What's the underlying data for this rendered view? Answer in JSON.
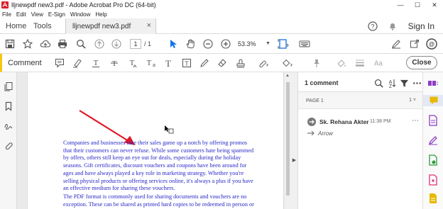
{
  "window": {
    "title": "lljnewpdf new3.pdf - Adobe Acrobat Pro DC (64-bit)",
    "controls": {
      "minimize": "—",
      "maximize": "☐",
      "close": "✕"
    }
  },
  "menubar": {
    "items": [
      "File",
      "Edit",
      "View",
      "E-Sign",
      "Window",
      "Help"
    ]
  },
  "tabs": {
    "home": "Home",
    "tools": "Tools",
    "document": "lljnewpdf new3.pdf",
    "close_glyph": "×"
  },
  "account": {
    "sign_in": "Sign In"
  },
  "toolbar": {
    "page_current": "1",
    "page_total": "/ 1",
    "zoom": "53.3%",
    "zoom_caret": "▼"
  },
  "comment_toolbar": {
    "label": "Comment",
    "close_label": "Close"
  },
  "document": {
    "paragraphs": [
      "Companies and businesses take their sales game up a notch by offering promos that their customers can never refuse. While some customers hate being spammed by offers, others still keep an eye out for deals, especially during the holiday seasons. Gift certificates, discount vouchers and coupons have been around for ages and have always played a key role in marketing strategy. Whether you're selling physical products or offering services online, it's always a plus if you have an effective medium for sharing these vouchers.",
      "The PDF format is commonly used for sharing documents and vouchers are no exception. These can be shared as printed hard copies to be redeemed in person or"
    ],
    "text_color": "#2828c8",
    "annotation_color": "#e0192a"
  },
  "comments_panel": {
    "count_label": "1 comment",
    "page_group": "PAGE 1",
    "page_group_count": "1 ˅",
    "comment": {
      "author": "Sk. Rehana Akter",
      "time": "11:38 PM",
      "more": "⋯",
      "type": "Arrow"
    }
  },
  "colors": {
    "comment_accent": "#f2c811",
    "tool_blue": "#1473e6",
    "rail_purple": "#8e3fc4",
    "rail_pink": "#e0337b",
    "rail_green": "#2d9d3a",
    "rail_yellow": "#e8b800"
  }
}
